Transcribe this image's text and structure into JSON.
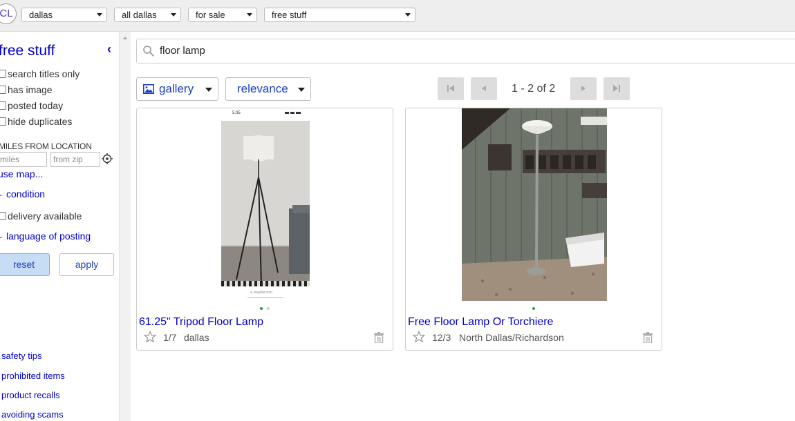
{
  "topbar": {
    "logo": "CL",
    "selects": {
      "city": "dallas",
      "area": "all dallas",
      "section": "for sale",
      "category": "free stuff"
    }
  },
  "sidebar": {
    "category_title": "free stuff",
    "collapse_glyph": "‹",
    "checkboxes": [
      "search titles only",
      "has image",
      "posted today",
      "hide duplicates"
    ],
    "miles_from_location": "MILES FROM LOCATION",
    "miles_placeholder": "miles",
    "zip_placeholder": "from zip",
    "use_map": "use map...",
    "condition": "condition",
    "delivery_available": "delivery available",
    "language_of_posting": "language of posting",
    "reset": "reset",
    "apply": "apply",
    "footer_links": [
      "safety tips",
      "prohibited items",
      "product recalls",
      "avoiding scams"
    ]
  },
  "search": {
    "query": "floor lamp"
  },
  "toolbar": {
    "view": "gallery",
    "sort": "relevance",
    "page_range": "1 - 2 of 2"
  },
  "results": [
    {
      "title": "61.25\" Tripod Floor Lamp",
      "date": "1/7",
      "location": "dallas",
      "phone_time": "5:35",
      "phone_url": "a. wayfair.com"
    },
    {
      "title": "Free Floor Lamp Or Torchiere",
      "date": "12/3",
      "location": "North Dallas/Richardson"
    }
  ],
  "colors": {
    "link": "#0000cc",
    "accent_button": "#c7dcf5",
    "dot_active": "#2a9a3a",
    "dot_inactive": "#cccccc"
  },
  "icons": [
    "search-icon",
    "gallery-icon",
    "crosshair-icon",
    "star-icon",
    "trash-icon",
    "first-page-icon",
    "prev-page-icon",
    "next-page-icon",
    "last-page-icon"
  ]
}
